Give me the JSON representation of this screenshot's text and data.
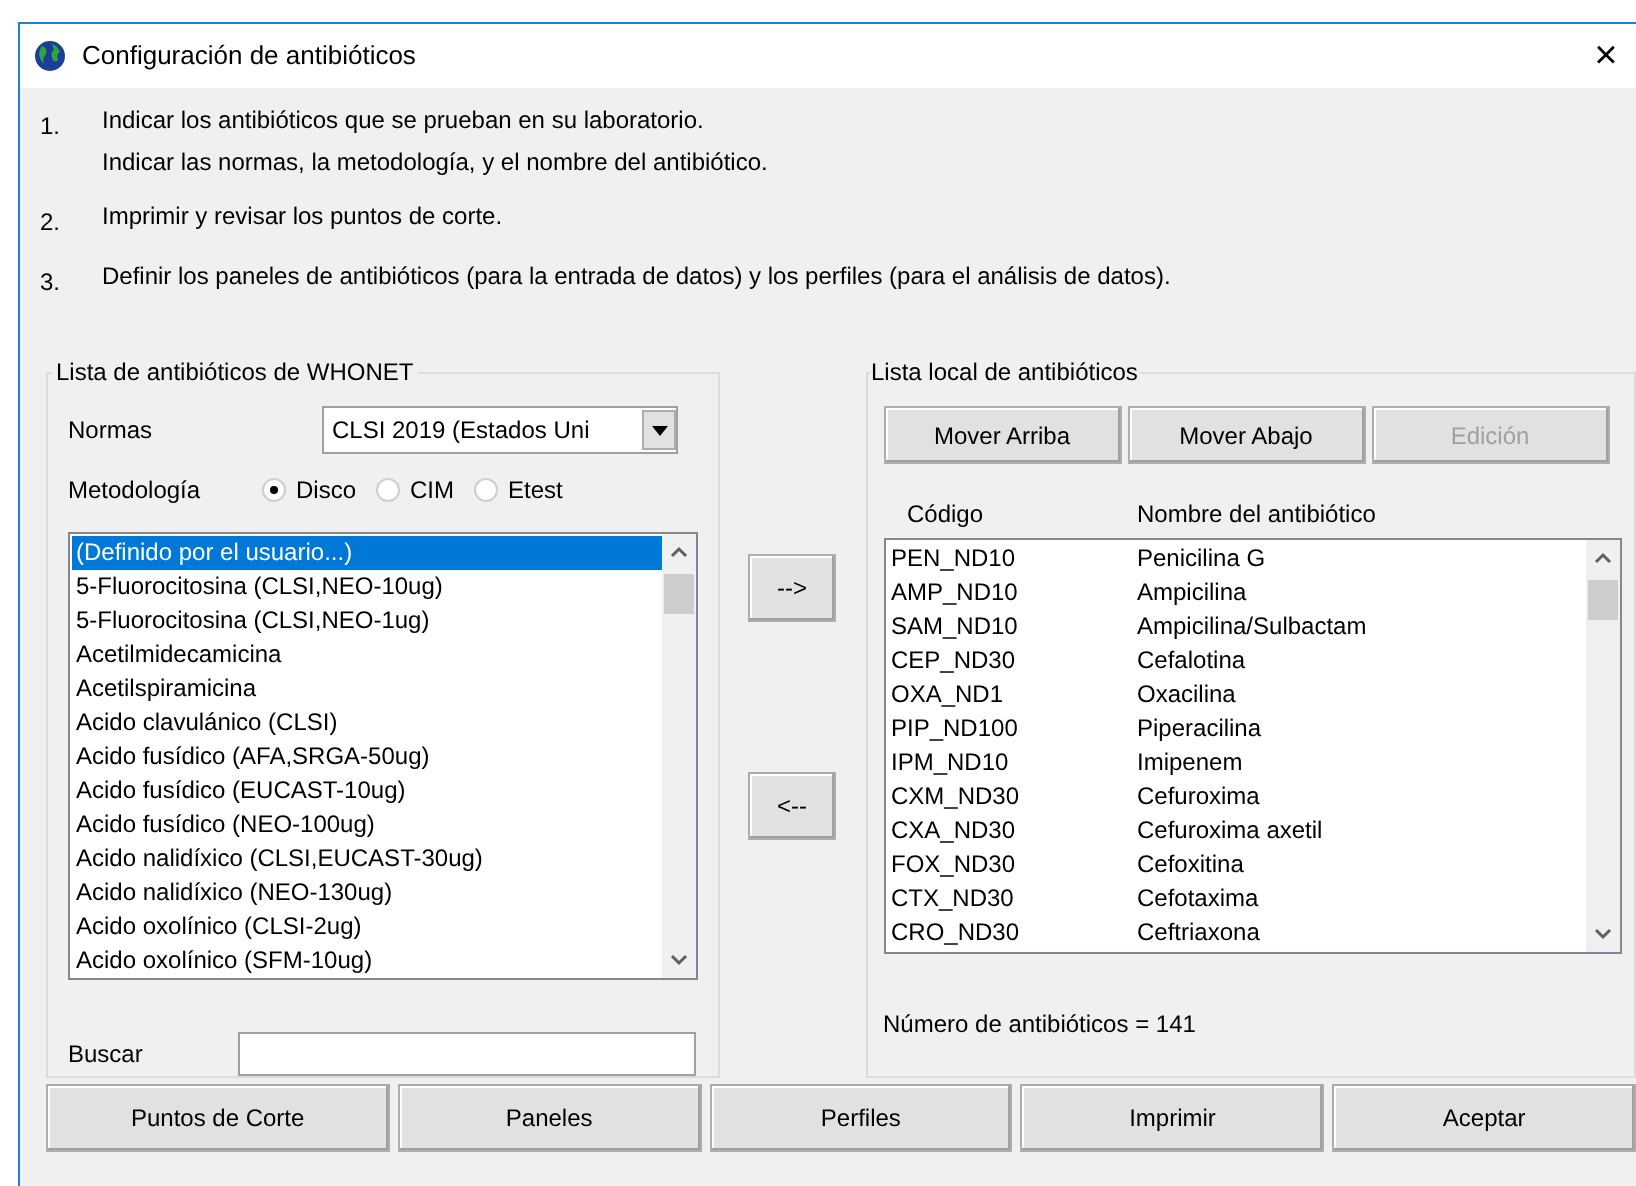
{
  "window": {
    "title": "Configuración de antibióticos",
    "close": "×"
  },
  "steps": [
    {
      "number": "1.",
      "lines": [
        "Indicar los antibióticos que se prueban en su laboratorio.",
        "Indicar las normas, la metodología, y el nombre del antibiótico."
      ]
    },
    {
      "number": "2.",
      "lines": [
        "Imprimir y revisar los puntos de corte."
      ]
    },
    {
      "number": "3.",
      "lines": [
        "Definir los paneles de antibióticos (para la entrada de datos) y los perfiles (para el análisis de datos)."
      ]
    }
  ],
  "whonet_group": {
    "title": "Lista de antibióticos de WHONET",
    "normas_label": "Normas",
    "normas_value": "CLSI 2019 (Estados Uni",
    "metodologia_label": "Metodología",
    "methods": [
      {
        "label": "Disco",
        "selected": true
      },
      {
        "label": "CIM",
        "selected": false
      },
      {
        "label": "Etest",
        "selected": false
      }
    ],
    "items": [
      {
        "label": "(Definido por el usuario...)",
        "selected": true
      },
      {
        "label": "5-Fluorocitosina (CLSI,NEO-10ug)",
        "selected": false
      },
      {
        "label": "5-Fluorocitosina (CLSI,NEO-1ug)",
        "selected": false
      },
      {
        "label": "Acetilmidecamicina",
        "selected": false
      },
      {
        "label": "Acetilspiramicina",
        "selected": false
      },
      {
        "label": "Acido clavulánico (CLSI)",
        "selected": false
      },
      {
        "label": "Acido fusídico (AFA,SRGA-50ug)",
        "selected": false
      },
      {
        "label": "Acido fusídico (EUCAST-10ug)",
        "selected": false
      },
      {
        "label": "Acido fusídico (NEO-100ug)",
        "selected": false
      },
      {
        "label": "Acido nalidíxico (CLSI,EUCAST-30ug)",
        "selected": false
      },
      {
        "label": "Acido nalidíxico (NEO-130ug)",
        "selected": false
      },
      {
        "label": "Acido oxolínico (CLSI-2ug)",
        "selected": false
      },
      {
        "label": "Acido oxolínico (SFM-10ug)",
        "selected": false
      }
    ],
    "search_label": "Buscar"
  },
  "transfer_buttons": [
    "-->",
    "<--"
  ],
  "local_group": {
    "title": "Lista local de antibióticos",
    "buttons": [
      {
        "label": "Mover Arriba",
        "disabled": false
      },
      {
        "label": "Mover Abajo",
        "disabled": false
      },
      {
        "label": "Edición",
        "disabled": true
      }
    ],
    "columns": [
      "Código",
      "Nombre del antibiótico"
    ],
    "rows": [
      [
        "PEN_ND10",
        "Penicilina G"
      ],
      [
        "AMP_ND10",
        "Ampicilina"
      ],
      [
        "SAM_ND10",
        "Ampicilina/Sulbactam"
      ],
      [
        "CEP_ND30",
        "Cefalotina"
      ],
      [
        "OXA_ND1",
        "Oxacilina"
      ],
      [
        "PIP_ND100",
        "Piperacilina"
      ],
      [
        "IPM_ND10",
        "Imipenem"
      ],
      [
        "CXM_ND30",
        "Cefuroxima"
      ],
      [
        "CXA_ND30",
        "Cefuroxima axetil"
      ],
      [
        "FOX_ND30",
        "Cefoxitina"
      ],
      [
        "CTX_ND30",
        "Cefotaxima"
      ],
      [
        "CRO_ND30",
        "Ceftriaxona"
      ]
    ],
    "count": "Número de antibióticos = 141"
  },
  "bottom_buttons": [
    "Puntos de Corte",
    "Paneles",
    "Perfiles",
    "Imprimir",
    "Aceptar"
  ]
}
